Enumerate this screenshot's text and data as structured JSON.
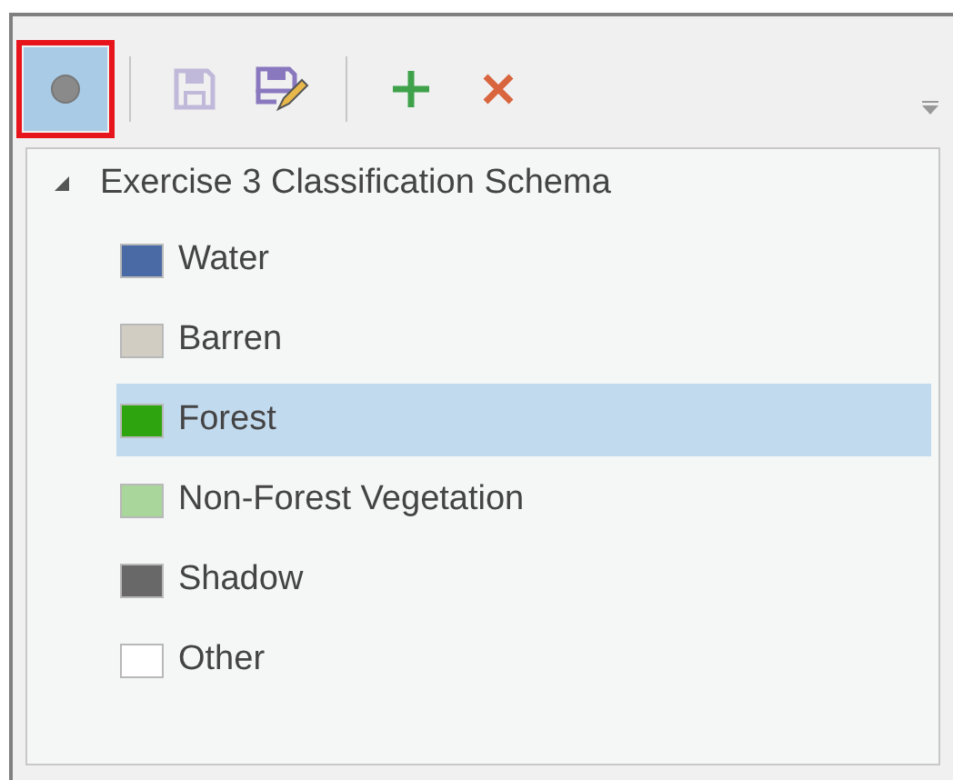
{
  "toolbar": {
    "buttons": [
      {
        "kind": "circle",
        "selected": true,
        "disabled": false,
        "highlighted": true
      },
      {
        "kind": "separator"
      },
      {
        "kind": "save",
        "selected": false,
        "disabled": true,
        "highlighted": false
      },
      {
        "kind": "save-edit",
        "selected": false,
        "disabled": false,
        "highlighted": false
      },
      {
        "kind": "separator"
      },
      {
        "kind": "add",
        "selected": false,
        "disabled": false,
        "highlighted": false
      },
      {
        "kind": "delete",
        "selected": false,
        "disabled": false,
        "highlighted": false
      }
    ]
  },
  "tree": {
    "label": "Exercise 3 Classification Schema",
    "expanded": true,
    "children": [
      {
        "label": "Water",
        "color": "#4a6aa5",
        "selected": false
      },
      {
        "label": "Barren",
        "color": "#d2cdc3",
        "selected": false
      },
      {
        "label": "Forest",
        "color": "#2ea50f",
        "selected": true
      },
      {
        "label": "Non-Forest Vegetation",
        "color": "#a9d69b",
        "selected": false
      },
      {
        "label": "Shadow",
        "color": "#686868",
        "selected": false
      },
      {
        "label": "Other",
        "color": "#ffffff",
        "selected": false
      }
    ]
  }
}
